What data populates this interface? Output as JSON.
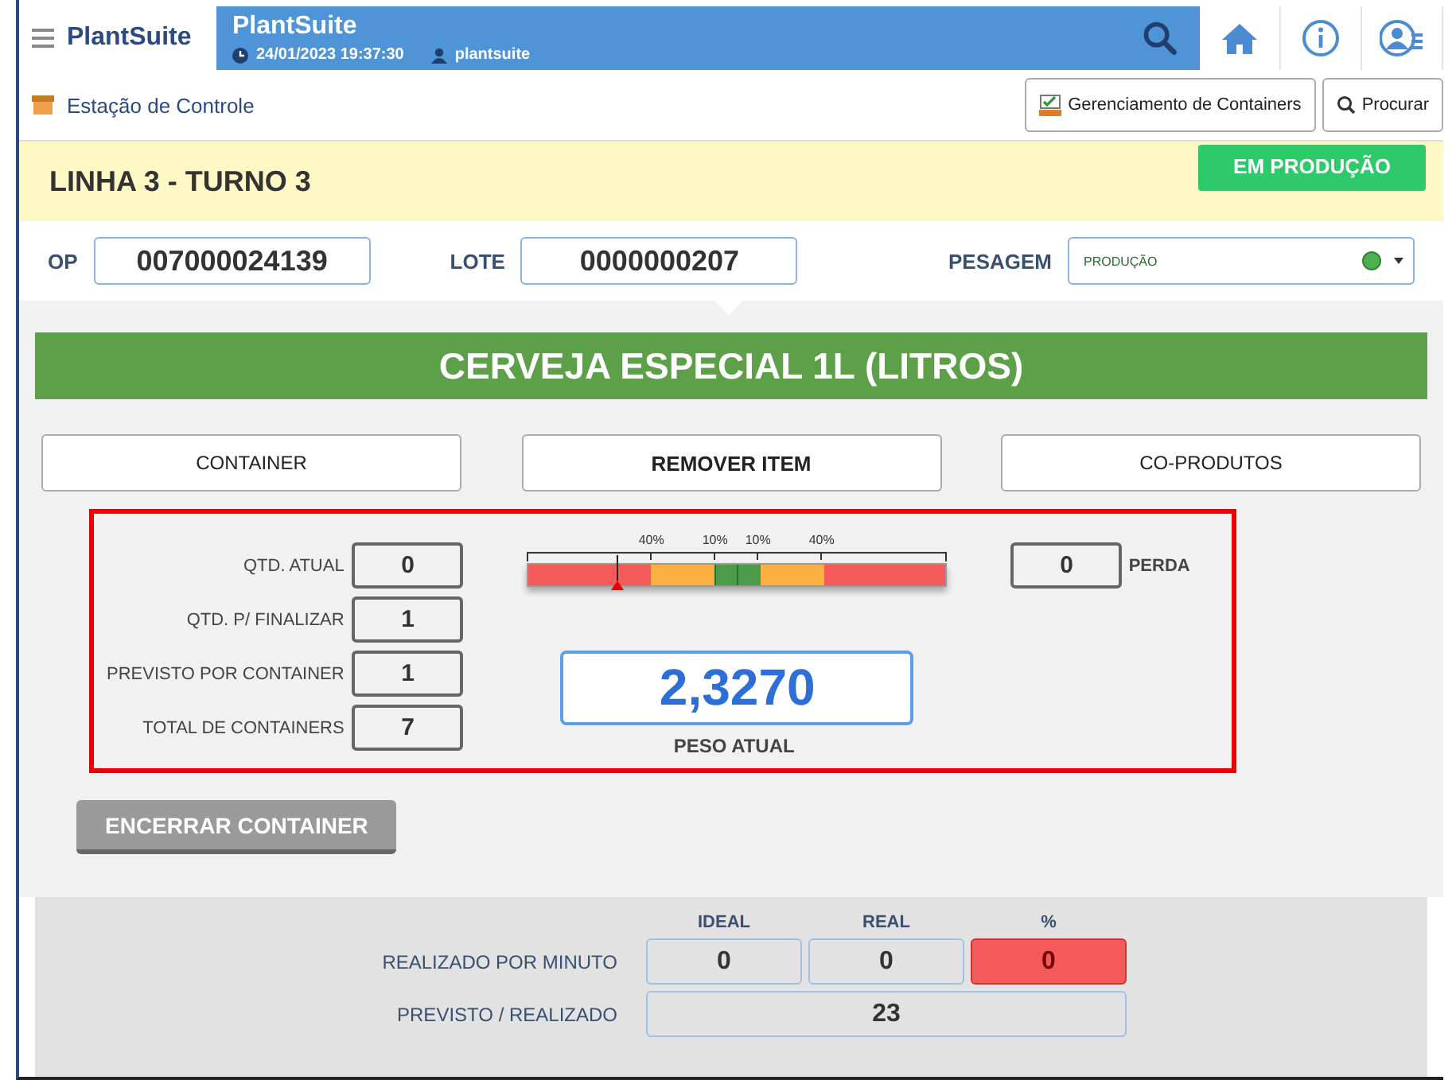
{
  "header": {
    "brand": "PlantSuite",
    "title": "PlantSuite",
    "datetime": "24/01/2023 19:37:30",
    "user": "plantsuite"
  },
  "toolbar": {
    "location": "Estação de Controle",
    "buttons": [
      {
        "label": "Gerenciamento de Containers",
        "kind": "containers"
      },
      {
        "label": "Procurar",
        "kind": "search"
      }
    ]
  },
  "line": {
    "title": "LINHA 3 - TURNO 3",
    "status": "EM PRODUÇÃO"
  },
  "fields": [
    {
      "label": "OP",
      "value": "007000024139"
    },
    {
      "label": "LOTE",
      "value": "0000000207"
    }
  ],
  "weighing": {
    "label": "PESAGEM",
    "value": "PRODUÇÃO"
  },
  "product": "CERVEJA ESPECIAL 1L (LITROS)",
  "actions": [
    {
      "label": "CONTAINER",
      "bold": false
    },
    {
      "label": "REMOVER ITEM",
      "bold": true
    },
    {
      "label": "CO-PRODUTOS",
      "bold": false
    }
  ],
  "counters": [
    {
      "label": "QTD. ATUAL",
      "value": "0"
    },
    {
      "label": "QTD. P/ FINALIZAR",
      "value": "1"
    },
    {
      "label": "PREVISTO POR CONTAINER",
      "value": "1"
    },
    {
      "label": "TOTAL DE CONTAINERS",
      "value": "7"
    }
  ],
  "gauge": {
    "ticks": [
      "40%",
      "10%",
      "10%",
      "40%"
    ],
    "level": 0.21
  },
  "weight": {
    "value": "2,3270",
    "label": "PESO ATUAL"
  },
  "loss": {
    "value": "0",
    "label": "PERDA"
  },
  "close_button": {
    "label": "ENCERRAR CONTAINER",
    "disabled": true
  },
  "summary": {
    "columns": [
      "IDEAL",
      "REAL",
      "%"
    ],
    "rows": [
      {
        "label": "REALIZADO POR MINUTO",
        "cells": [
          {
            "value": "0",
            "alert": false
          },
          {
            "value": "0",
            "alert": false
          },
          {
            "value": "0",
            "alert": true
          }
        ]
      },
      {
        "label": "PREVISTO / REALIZADO",
        "total": "23"
      }
    ]
  }
}
